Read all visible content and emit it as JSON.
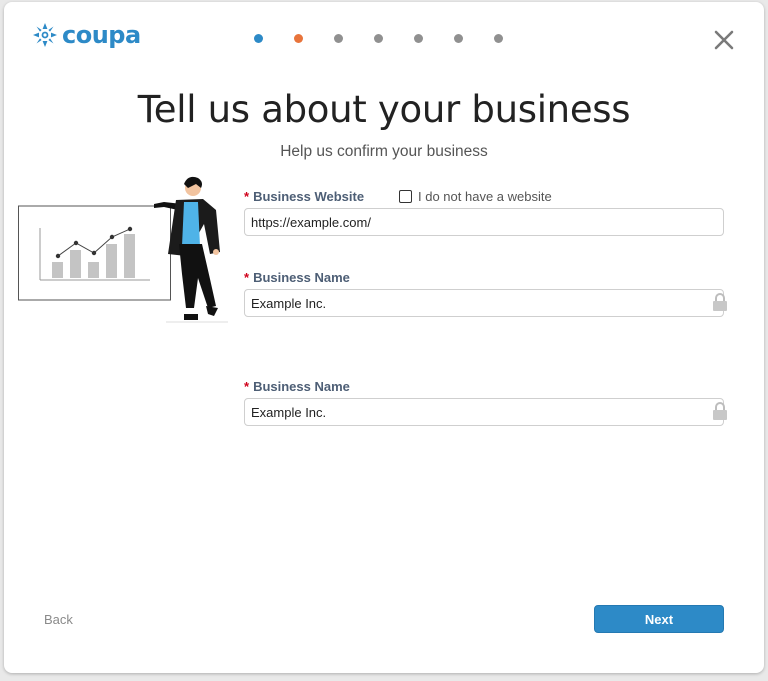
{
  "brand": {
    "name": "coupa",
    "color": "#2d8ac7",
    "icon": "snowflake-logo-icon"
  },
  "progress": {
    "total_steps": 7,
    "current_step": 2,
    "completed": 1
  },
  "header": {
    "close_icon": "close-icon"
  },
  "page": {
    "title": "Tell us about your business",
    "subtitle": "Help us confirm your business"
  },
  "form": {
    "website": {
      "label": "Business Website",
      "required_marker": "*",
      "value": "https://example.com/",
      "no_website_label": "I do not have a website",
      "no_website_checked": false
    },
    "name_1": {
      "label": "Business Name",
      "required_marker": "*",
      "value": "Example Inc.",
      "locked": true
    },
    "name_2": {
      "label": "Business Name",
      "required_marker": "*",
      "value": "Example Inc.",
      "locked": true
    }
  },
  "footer": {
    "back_label": "Back",
    "next_label": "Next"
  },
  "colors": {
    "accent": "#2d8ac7",
    "current_step": "#e8743b",
    "required": "#d0021b"
  }
}
